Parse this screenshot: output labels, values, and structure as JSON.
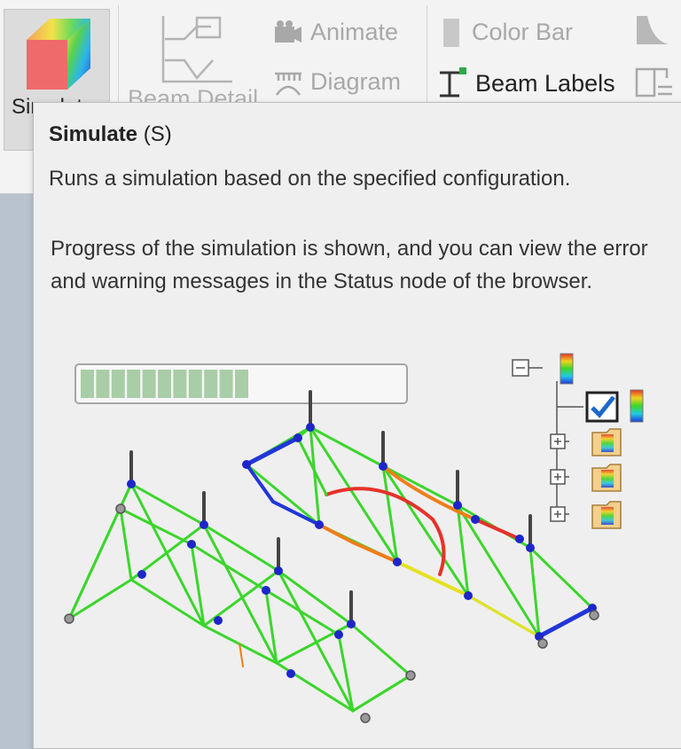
{
  "ribbon": {
    "simulate_label": "Simulate",
    "beam_detail_label": "Beam Detail",
    "animate_label": "Animate",
    "diagram_label": "Diagram",
    "color_bar_label": "Color Bar",
    "beam_labels_label": "Beam Labels"
  },
  "tooltip": {
    "title": "Simulate",
    "shortcut": "(S)",
    "summary": "Runs a simulation based on the specified configuration.",
    "detail": "Progress of the simulation is shown, and you can view the error and warning messages in the Status node of the browser.",
    "illustration": {
      "progress_fraction": 0.55,
      "progress_segments_filled": 11,
      "tree_checkbox_checked": true
    }
  },
  "colors": {
    "beam_green": "#3bd62b",
    "beam_yellow": "#e6e21f",
    "beam_orange": "#f07d18",
    "beam_red": "#e5322a",
    "beam_blue": "#2136d8",
    "node_blue": "#1e26c9",
    "progress_fill": "#a9cda6",
    "checkbox_accent": "#1e69c8"
  }
}
